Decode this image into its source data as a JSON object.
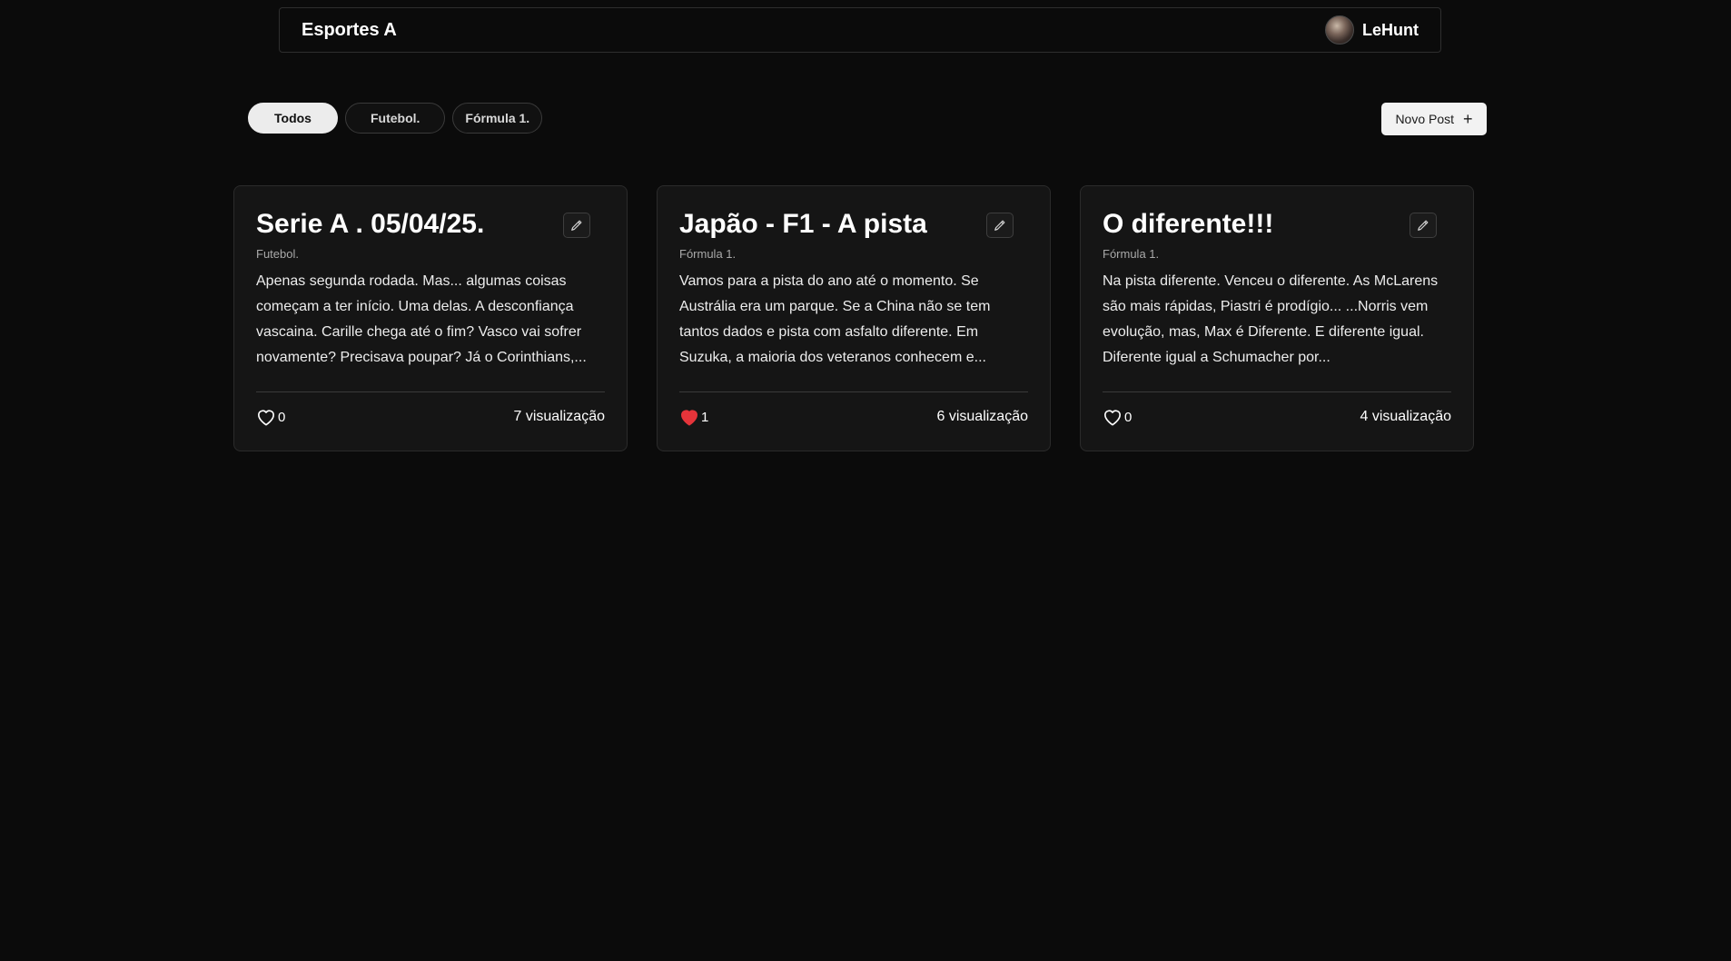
{
  "header": {
    "brand": "Esportes A",
    "username": "LeHunt"
  },
  "filters": [
    {
      "label": "Todos",
      "active": true
    },
    {
      "label": "Futebol.",
      "active": false
    },
    {
      "label": "Fórmula 1.",
      "active": false
    }
  ],
  "new_post": {
    "label": "Novo Post",
    "icon": "plus-icon"
  },
  "posts": [
    {
      "title": "Serie A . 05/04/25.",
      "category": "Futebol.",
      "excerpt": "Apenas segunda rodada. Mas... algumas coisas começam a ter início. Uma delas. A desconfiança vascaina. Carille chega até o fim? Vasco vai sofrer novamente? Precisava poupar? Já o Corinthians,...",
      "likes": "0",
      "liked": false,
      "views": "7 visualização"
    },
    {
      "title": "Japão - F1 - A pista",
      "category": "Fórmula 1.",
      "excerpt": "Vamos para a pista do ano até o momento. Se Austrália era um parque. Se a China não se tem tantos dados e pista com asfalto diferente. Em Suzuka, a maioria dos veteranos conhecem e...",
      "likes": "1",
      "liked": true,
      "views": "6 visualização"
    },
    {
      "title": "O diferente!!!",
      "category": "Fórmula 1.",
      "excerpt": "Na pista diferente. Venceu o diferente. As McLarens são mais rápidas, Piastri é prodígio... ...Norris vem evolução, mas, Max é Diferente. E diferente igual. Diferente igual a Schumacher por...",
      "likes": "0",
      "liked": false,
      "views": "4 visualização"
    }
  ],
  "colors": {
    "background": "#0b0b0b",
    "card": "#151515",
    "liked_heart": "#e5343a",
    "chip_active": "#ececec"
  }
}
